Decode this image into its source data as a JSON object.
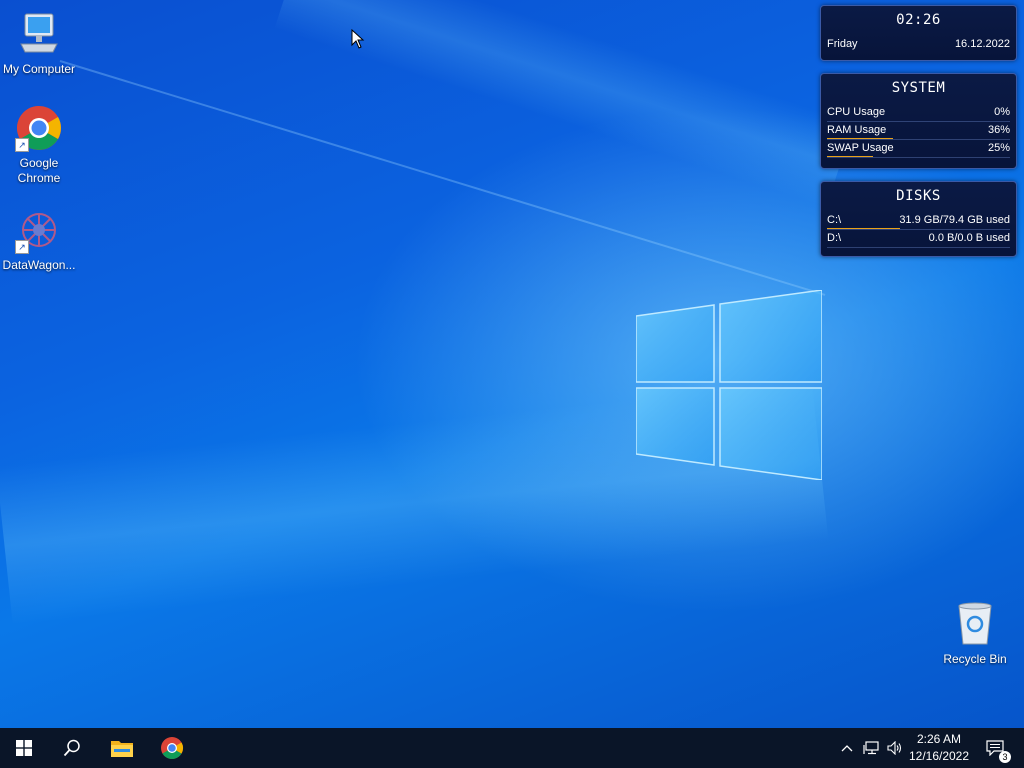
{
  "desktop": {
    "icons": [
      {
        "label": "My Computer"
      },
      {
        "label": "Google Chrome"
      },
      {
        "label": "DataWagon..."
      },
      {
        "label": "Recycle Bin"
      }
    ]
  },
  "widgets": {
    "clock": {
      "time": "02:26",
      "day": "Friday",
      "date": "16.12.2022"
    },
    "system": {
      "title": "SYSTEM",
      "rows": [
        {
          "label": "CPU Usage",
          "value": "0%",
          "fraction": 0.0
        },
        {
          "label": "RAM Usage",
          "value": "36%",
          "fraction": 0.36
        },
        {
          "label": "SWAP Usage",
          "value": "25%",
          "fraction": 0.25
        }
      ]
    },
    "disks": {
      "title": "DISKS",
      "rows": [
        {
          "label": "C:\\",
          "value": "31.9 GB/79.4 GB used",
          "fraction": 0.4
        },
        {
          "label": "D:\\",
          "value": "0.0 B/0.0 B used",
          "fraction": 0.0
        }
      ]
    },
    "accent_color": "#e9a21a"
  },
  "taskbar": {
    "start_icon": "windows-start-icon",
    "search_icon": "search-icon",
    "apps": [
      "file-explorer-icon",
      "chrome-icon"
    ],
    "tray": {
      "time": "2:26 AM",
      "date": "12/16/2022",
      "notification_count": "3"
    }
  },
  "colors": {
    "desktop_blue": "#0b63e0",
    "taskbar": "#0a1528"
  }
}
